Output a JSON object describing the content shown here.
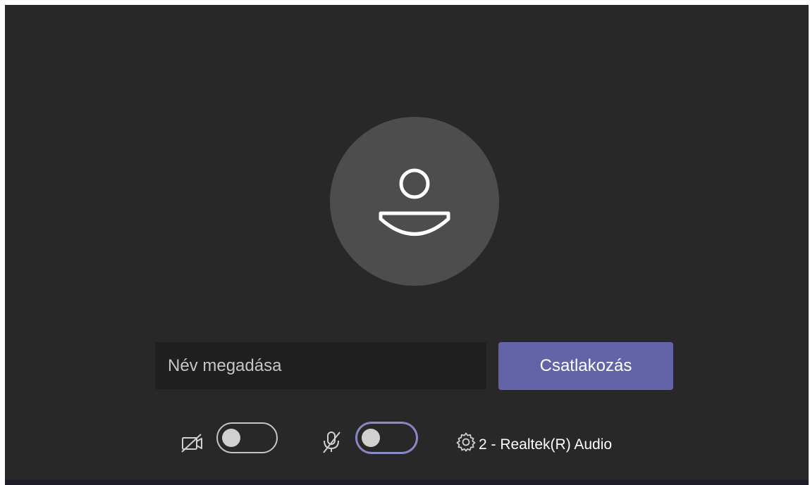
{
  "name_field": {
    "placeholder": "Név megadása"
  },
  "join_button": {
    "label": "Csatlakozás"
  },
  "controls": {
    "camera": {
      "icon": "camera-off-icon",
      "enabled": false
    },
    "microphone": {
      "icon": "microphone-off-icon",
      "enabled": false
    },
    "device_settings": {
      "icon": "gear-icon",
      "label": "2 - Realtek(R) Audio"
    }
  },
  "colors": {
    "background": "#292829",
    "avatar": "#4e4d4e",
    "input": "#201f20",
    "accent": "#6264a7",
    "toggle_focus": "#8b8cc7"
  }
}
